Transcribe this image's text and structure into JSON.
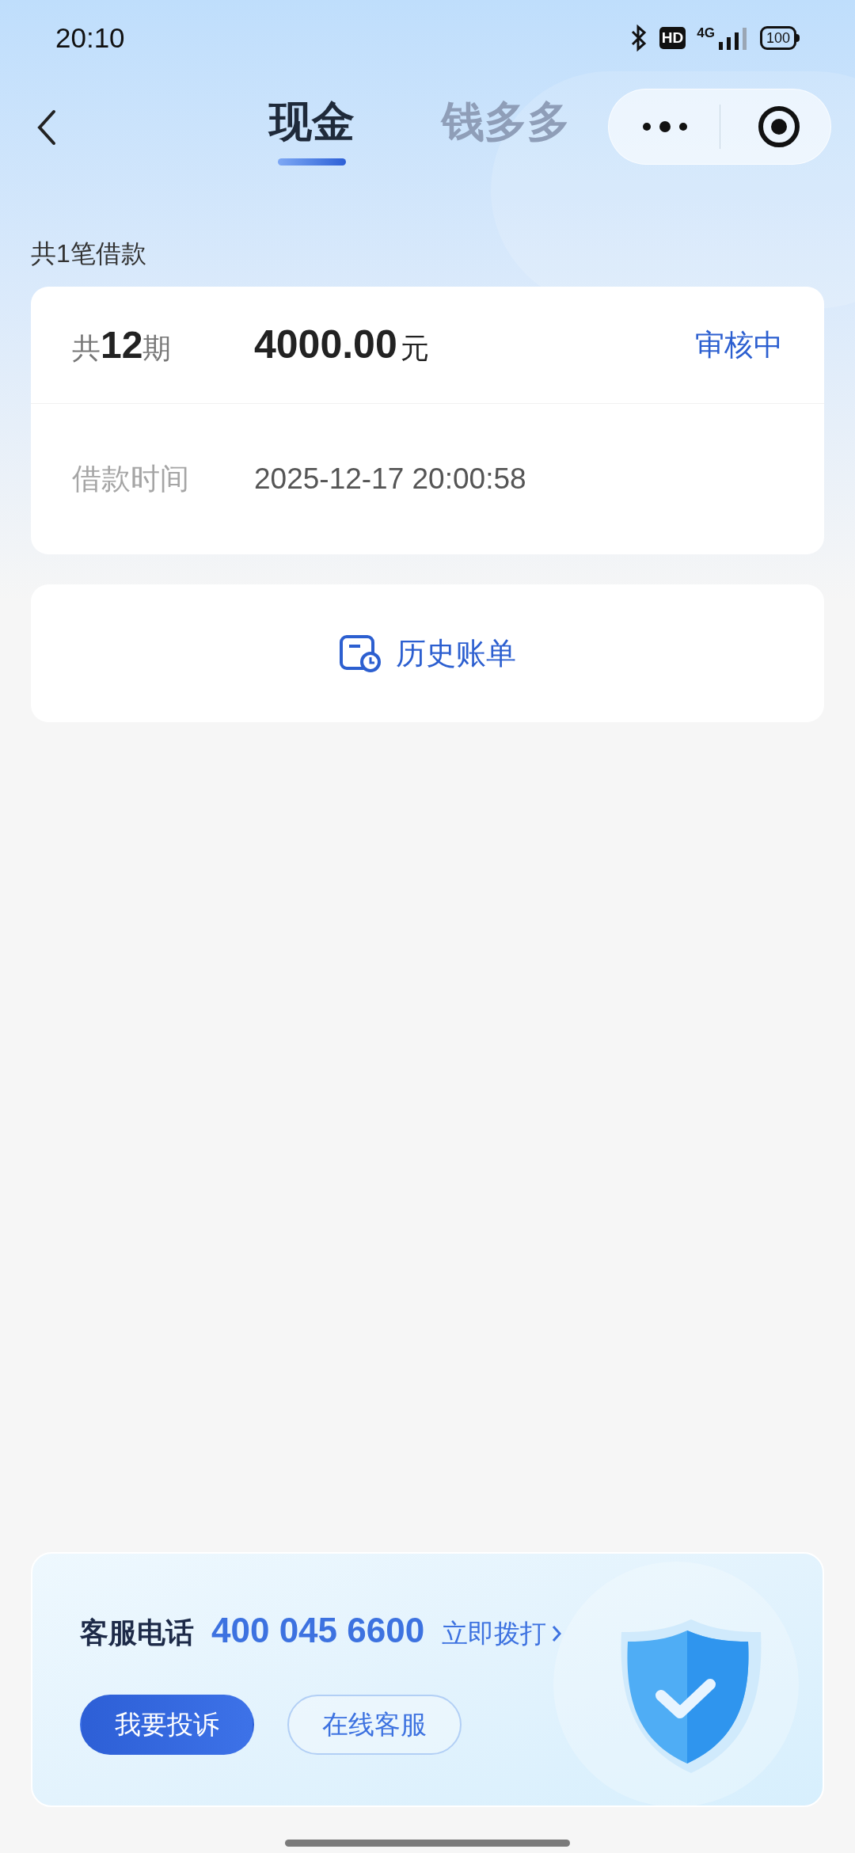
{
  "status_bar": {
    "time": "20:10",
    "battery": "100",
    "network": "4G",
    "hd": "HD"
  },
  "tabs": [
    {
      "label": "现金",
      "selected": true
    },
    {
      "label": "钱多多",
      "selected": false
    }
  ],
  "loan_count": "共1笔借款",
  "loan": {
    "periods": "共**12**期",
    "amount": "4000.00",
    "unit": "元",
    "status": "审核中",
    "time_label": "借款时间",
    "time": "2025-12-17 20:00:58"
  },
  "history_button": "历史账单",
  "service": {
    "label": "客服电话",
    "phone": "400 045 6600",
    "call": "立即拨打",
    "buttons": [
      {
        "label": "我要投诉",
        "kind": "primary"
      },
      {
        "label": "在线客服",
        "kind": "outline"
      }
    ]
  }
}
